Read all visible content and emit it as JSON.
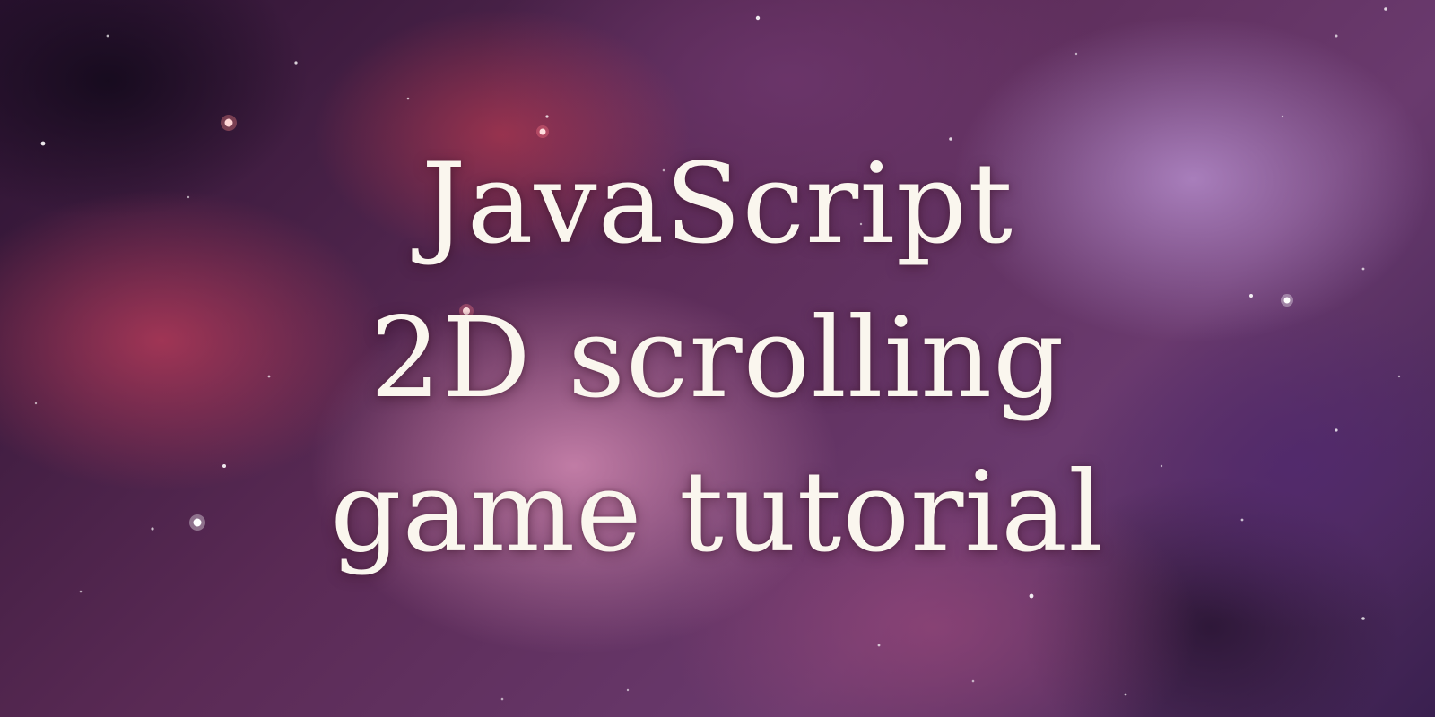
{
  "banner": {
    "title_lines": [
      "JavaScript",
      "2D scrolling",
      "game tutorial"
    ]
  },
  "colors": {
    "title_text": "#faf6ee",
    "nebula_pink": "#e296be",
    "nebula_purple": "#bea0d7",
    "nebula_red": "#be3c5a",
    "space_dark": "#1a0c1c"
  }
}
